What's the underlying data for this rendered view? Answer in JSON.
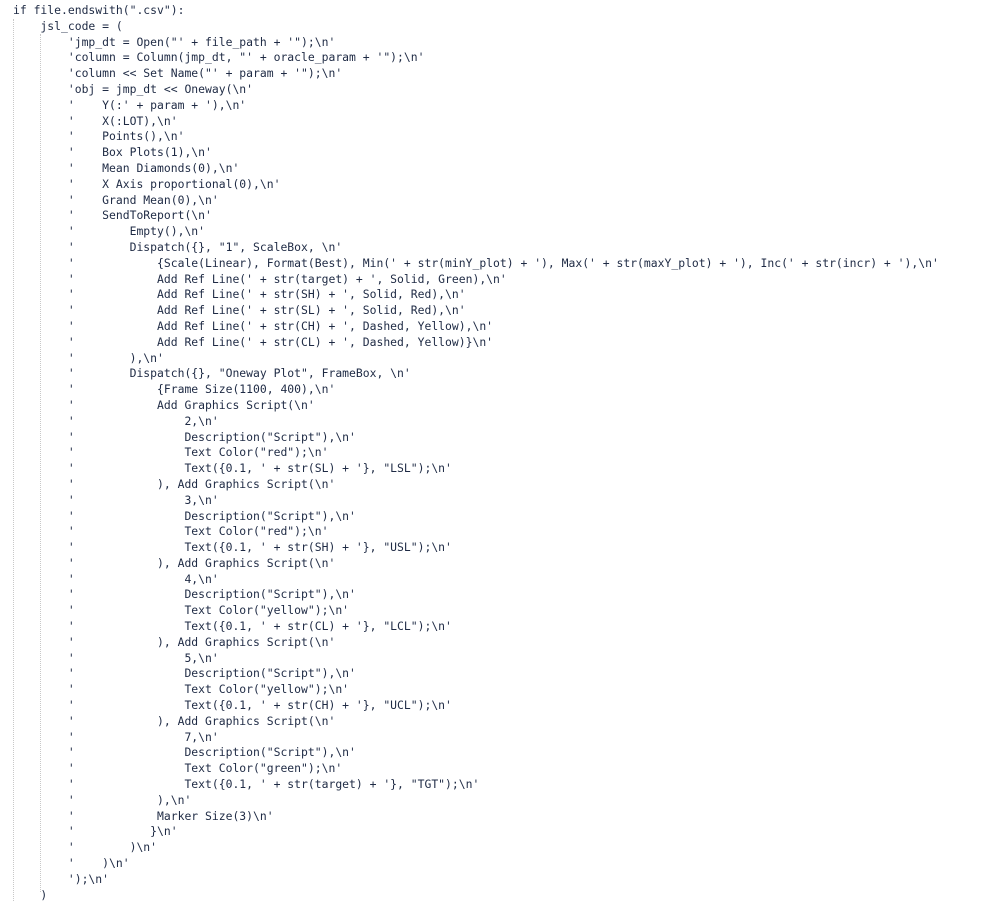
{
  "editor": {
    "lines": [
      "if file.endswith(\".csv\"):",
      "    jsl_code = (",
      "        'jmp_dt = Open(\"' + file_path + '\");\\n'",
      "        'column = Column(jmp_dt, \"' + oracle_param + '\");\\n'",
      "        'column << Set Name(\"' + param + '\");\\n'",
      "        'obj = jmp_dt << Oneway(\\n'",
      "        '    Y(:' + param + '),\\n'",
      "        '    X(:LOT),\\n'",
      "        '    Points(),\\n'",
      "        '    Box Plots(1),\\n'",
      "        '    Mean Diamonds(0),\\n'",
      "        '    X Axis proportional(0),\\n'",
      "        '    Grand Mean(0),\\n'",
      "        '    SendToReport(\\n'",
      "        '        Empty(),\\n'",
      "        '        Dispatch({}, \"1\", ScaleBox, \\n'",
      "        '            {Scale(Linear), Format(Best), Min(' + str(minY_plot) + '), Max(' + str(maxY_plot) + '), Inc(' + str(incr) + '),\\n'",
      "        '            Add Ref Line(' + str(target) + ', Solid, Green),\\n'",
      "        '            Add Ref Line(' + str(SH) + ', Solid, Red),\\n'",
      "        '            Add Ref Line(' + str(SL) + ', Solid, Red),\\n'",
      "        '            Add Ref Line(' + str(CH) + ', Dashed, Yellow),\\n'",
      "        '            Add Ref Line(' + str(CL) + ', Dashed, Yellow)}\\n'",
      "        '        ),\\n'",
      "        '        Dispatch({}, \"Oneway Plot\", FrameBox, \\n'",
      "        '            {Frame Size(1100, 400),\\n'",
      "        '            Add Graphics Script(\\n'",
      "        '                2,\\n'",
      "        '                Description(\"Script\"),\\n'",
      "        '                Text Color(\"red\");\\n'",
      "        '                Text({0.1, ' + str(SL) + '}, \"LSL\");\\n'",
      "        '            ), Add Graphics Script(\\n'",
      "        '                3,\\n'",
      "        '                Description(\"Script\"),\\n'",
      "        '                Text Color(\"red\");\\n'",
      "        '                Text({0.1, ' + str(SH) + '}, \"USL\");\\n'",
      "        '            ), Add Graphics Script(\\n'",
      "        '                4,\\n'",
      "        '                Description(\"Script\"),\\n'",
      "        '                Text Color(\"yellow\");\\n'",
      "        '                Text({0.1, ' + str(CL) + '}, \"LCL\");\\n'",
      "        '            ), Add Graphics Script(\\n'",
      "        '                5,\\n'",
      "        '                Description(\"Script\"),\\n'",
      "        '                Text Color(\"yellow\");\\n'",
      "        '                Text({0.1, ' + str(CH) + '}, \"UCL\");\\n'",
      "        '            ), Add Graphics Script(\\n'",
      "        '                7,\\n'",
      "        '                Description(\"Script\"),\\n'",
      "        '                Text Color(\"green\");\\n'",
      "        '                Text({0.1, ' + str(target) + '}, \"TGT\");\\n'",
      "        '            ),\\n'",
      "        '            Marker Size(3)\\n'",
      "        '           }\\n'",
      "        '        )\\n'",
      "        '    )\\n'",
      "        ');\\n'",
      "    )"
    ]
  }
}
